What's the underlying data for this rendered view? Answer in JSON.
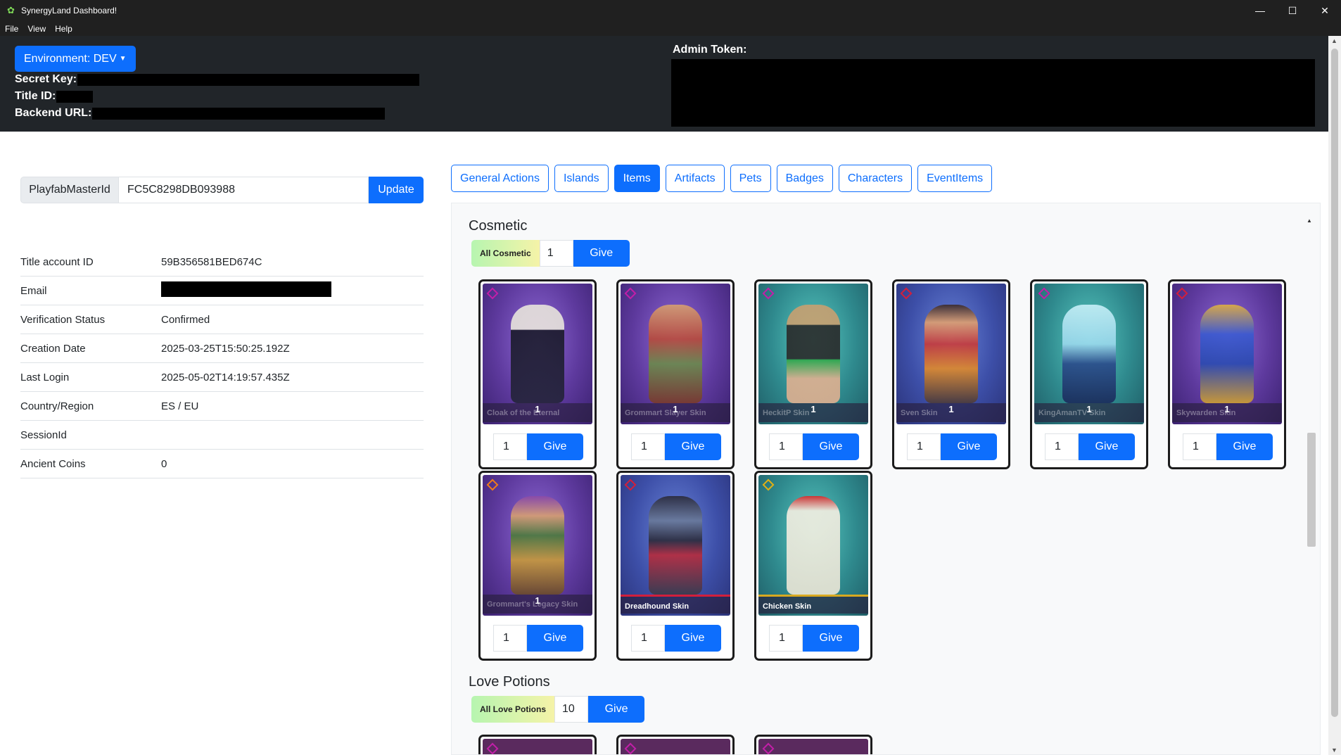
{
  "window": {
    "title": "SynergyLand Dashboard!",
    "minimize": "—",
    "maximize": "☐",
    "close": "✕"
  },
  "menu": [
    "File",
    "View",
    "Help"
  ],
  "header": {
    "environment_label": "Environment: DEV",
    "secret_key_label": "Secret Key:",
    "title_id_label": "Title ID:",
    "backend_url_label": "Backend URL:",
    "admin_token_label": "Admin Token:"
  },
  "player": {
    "master_id_label": "PlayfabMasterId",
    "master_id_value": "FC5C8298DB093988",
    "update_label": "Update"
  },
  "account_info": [
    {
      "key": "Title account ID",
      "value": "59B356581BED674C"
    },
    {
      "key": "Email",
      "value": ""
    },
    {
      "key": "Verification Status",
      "value": "Confirmed"
    },
    {
      "key": "Creation Date",
      "value": "2025-03-25T15:50:25.192Z"
    },
    {
      "key": "Last Login",
      "value": "2025-05-02T14:19:57.435Z"
    },
    {
      "key": "Country/Region",
      "value": "ES / EU"
    },
    {
      "key": "SessionId",
      "value": ""
    },
    {
      "key": "Ancient Coins",
      "value": "0"
    }
  ],
  "tabs": [
    {
      "label": "General Actions",
      "active": false
    },
    {
      "label": "Islands",
      "active": false
    },
    {
      "label": "Items",
      "active": true
    },
    {
      "label": "Artifacts",
      "active": false
    },
    {
      "label": "Pets",
      "active": false
    },
    {
      "label": "Badges",
      "active": false
    },
    {
      "label": "Characters",
      "active": false
    },
    {
      "label": "EventItems",
      "active": false
    }
  ],
  "sections": {
    "cosmetic": {
      "title": "Cosmetic",
      "all_label": "All Cosmetic",
      "all_qty": "1",
      "give_label": "Give",
      "items": [
        {
          "name": "Cloak of the Eternal",
          "count": "1",
          "qty": "1",
          "give": "Give",
          "bg": "purple",
          "rarity_color": "#c21ea8"
        },
        {
          "name": "Grommart Slayer Skin",
          "count": "1",
          "qty": "1",
          "give": "Give",
          "bg": "purple",
          "rarity_color": "#c21ea8"
        },
        {
          "name": "HeckitP Skin",
          "count": "1",
          "qty": "1",
          "give": "Give",
          "bg": "teal",
          "rarity_color": "#c21ea8"
        },
        {
          "name": "Sven Skin",
          "count": "1",
          "qty": "1",
          "give": "Give",
          "bg": "blue",
          "rarity_color": "#d21f3c"
        },
        {
          "name": "KingAmanTV Skin",
          "count": "1",
          "qty": "1",
          "give": "Give",
          "bg": "teal",
          "rarity_color": "#c21ea8"
        },
        {
          "name": "Skywarden Skin",
          "count": "1",
          "qty": "1",
          "give": "Give",
          "bg": "purple",
          "rarity_color": "#d21f3c"
        },
        {
          "name": "Grommart's Legacy Skin",
          "count": "1",
          "qty": "1",
          "give": "Give",
          "bg": "purple",
          "rarity_color": "#f07a1a"
        },
        {
          "name": "Dreadhound Skin",
          "count": "",
          "qty": "1",
          "give": "Give",
          "bg": "blue",
          "rarity_color": "#d21f3c"
        },
        {
          "name": "Chicken Skin",
          "count": "",
          "qty": "1",
          "give": "Give",
          "bg": "teal",
          "rarity_color": "#e0b015"
        }
      ]
    },
    "love_potions": {
      "title": "Love Potions",
      "all_label": "All Love Potions",
      "all_qty": "10",
      "give_label": "Give"
    }
  },
  "colors": {
    "primary": "#0d6efd",
    "header_bg": "#212529",
    "titlebar_bg": "#202020"
  }
}
